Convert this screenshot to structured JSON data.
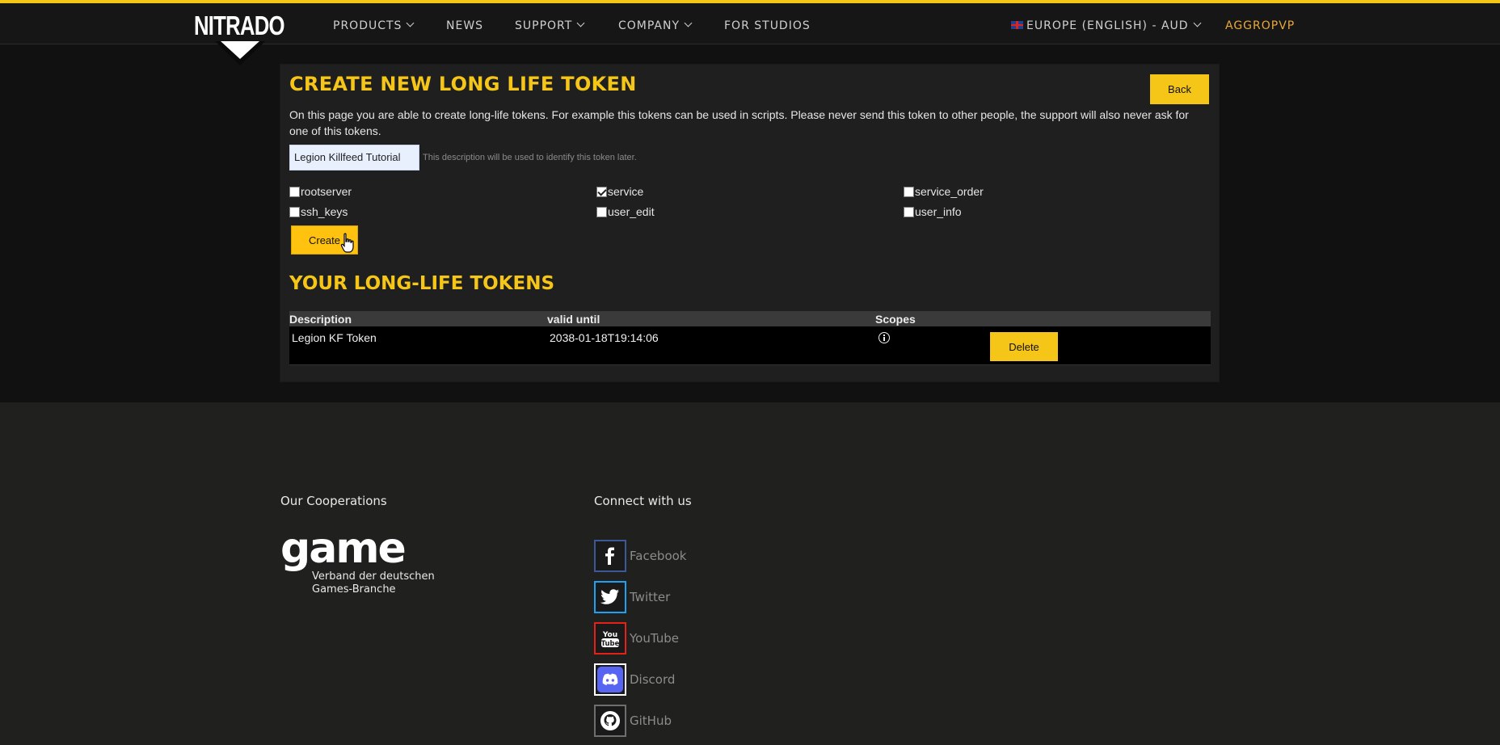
{
  "nav": {
    "logo": "NITRADO",
    "items": [
      {
        "label": "PRODUCTS",
        "has_dropdown": true
      },
      {
        "label": "NEWS",
        "has_dropdown": false
      },
      {
        "label": "SUPPORT",
        "has_dropdown": true
      },
      {
        "label": "COMPANY",
        "has_dropdown": true
      },
      {
        "label": "FOR STUDIOS",
        "has_dropdown": false
      }
    ],
    "region": "EUROPE (ENGLISH) - AUD",
    "user": "AGGROPVP"
  },
  "create": {
    "title": "CREATE NEW LONG LIFE TOKEN",
    "back_label": "Back",
    "intro": "On this page you are able to create long-life tokens. For example this tokens can be used in scripts. Please never send this token to other people, the support will also never ask for one of this tokens.",
    "description_value": "Legion Killfeed Tutorial",
    "description_hint": "This description will be used to identify this token later.",
    "scopes": [
      {
        "name": "rootserver",
        "checked": false
      },
      {
        "name": "service",
        "checked": true
      },
      {
        "name": "service_order",
        "checked": false
      },
      {
        "name": "ssh_keys",
        "checked": false
      },
      {
        "name": "user_edit",
        "checked": false
      },
      {
        "name": "user_info",
        "checked": false
      }
    ],
    "create_label": "Create"
  },
  "tokens": {
    "title": "YOUR LONG-LIFE TOKENS",
    "columns": [
      "Description",
      "valid until",
      "Scopes"
    ],
    "rows": [
      {
        "description": "Legion KF Token",
        "valid_until": "2038-01-18T19:14:06",
        "scopes_icon": "info-icon",
        "delete_label": "Delete"
      }
    ]
  },
  "footer": {
    "cooperations_title": "Our Cooperations",
    "game_logo_text": "game",
    "game_sub_1": "Verband der deutschen",
    "game_sub_2": "Games-Branche",
    "connect_title": "Connect with us",
    "social": [
      {
        "name": "Facebook",
        "icon": "facebook-icon",
        "color": "#3b5998"
      },
      {
        "name": "Twitter",
        "icon": "twitter-icon",
        "color": "#1da1f2"
      },
      {
        "name": "YouTube",
        "icon": "youtube-icon",
        "color": "#e62117"
      },
      {
        "name": "Discord",
        "icon": "discord-icon",
        "color": "#ffffff"
      },
      {
        "name": "GitHub",
        "icon": "github-icon",
        "color": "#6e6e6e"
      }
    ]
  },
  "colors": {
    "accent": "#f5c518",
    "user": "#e8a93a"
  }
}
